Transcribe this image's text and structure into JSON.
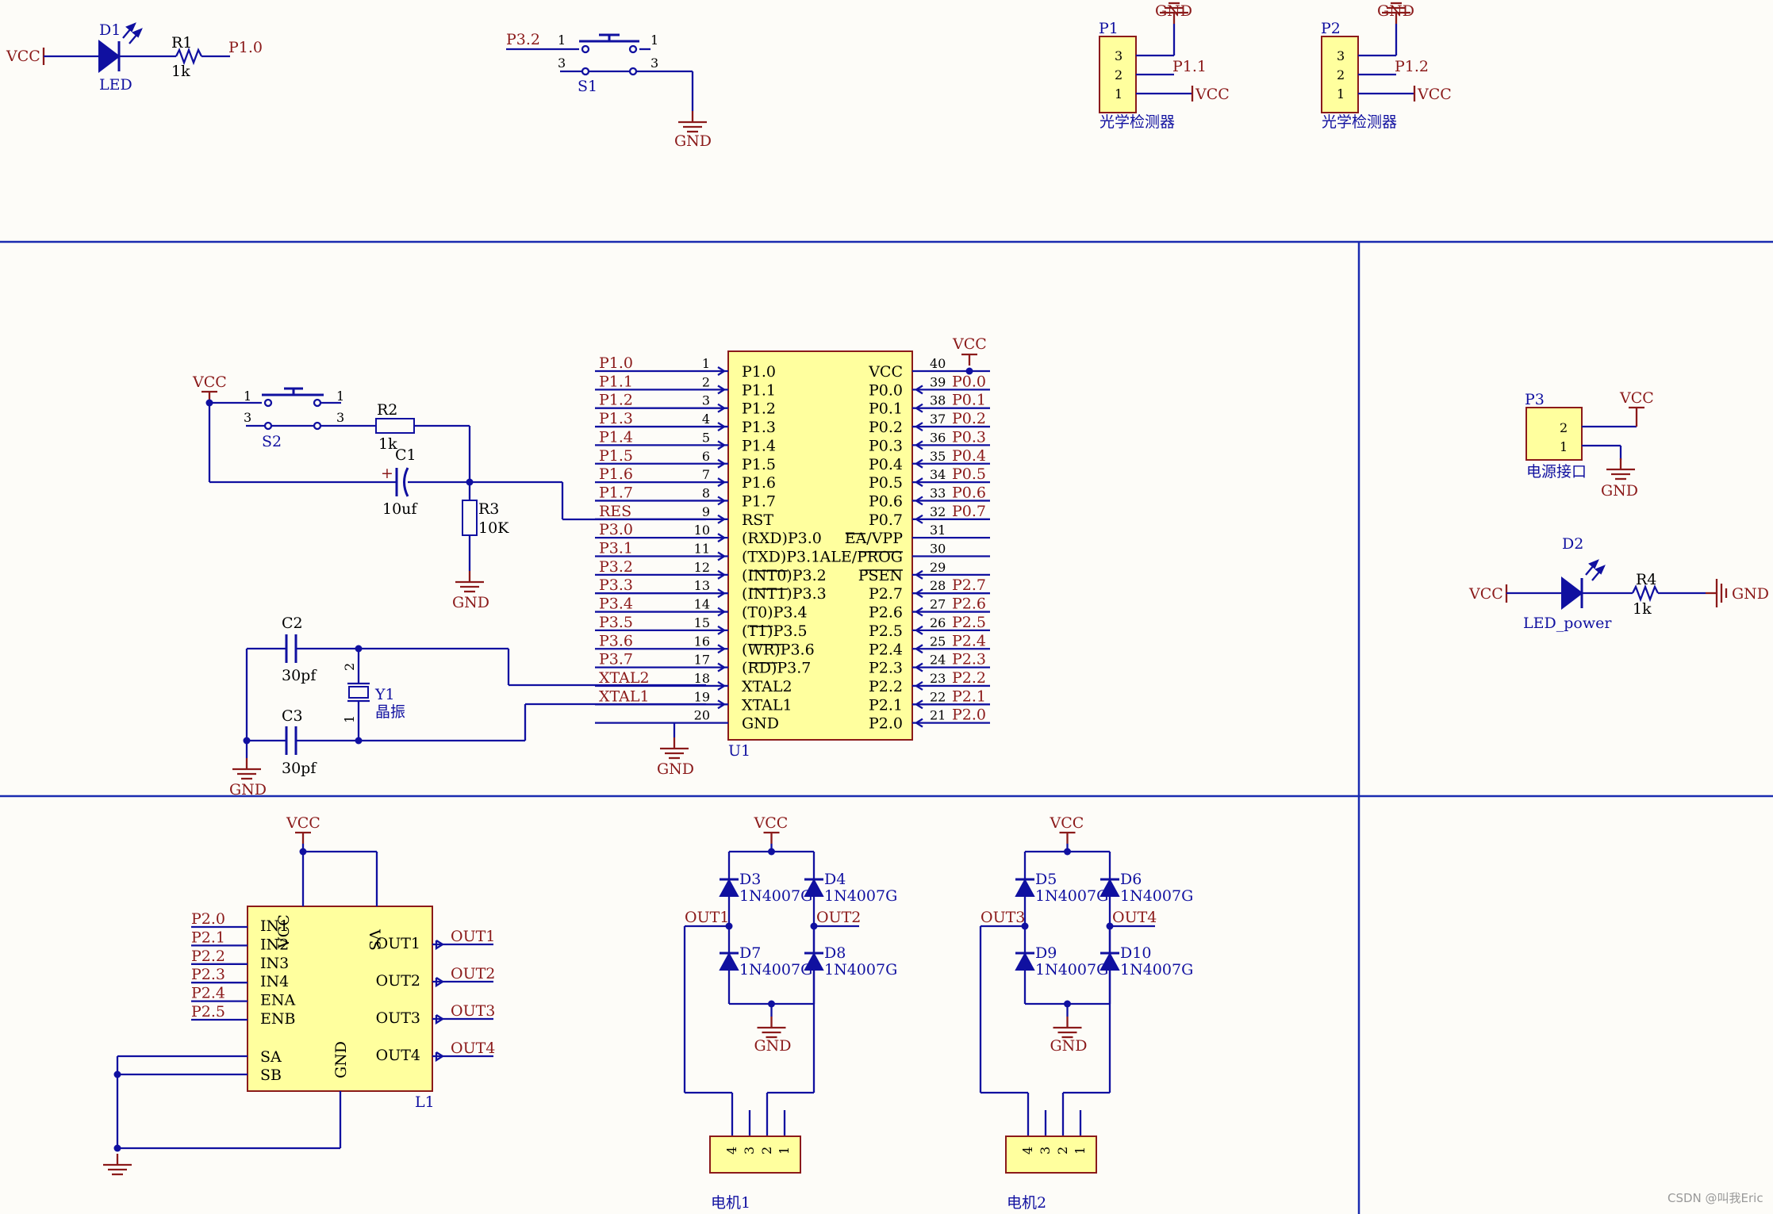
{
  "power": {
    "vcc": "VCC",
    "gnd": "GND"
  },
  "top": {
    "d1": {
      "ref": "D1",
      "name": "LED"
    },
    "r1": {
      "ref": "R1",
      "value": "1k",
      "net": "P1.0"
    },
    "s1": {
      "ref": "S1",
      "net": "P3.2",
      "pin1": "1",
      "pin3": "3"
    },
    "p1": {
      "ref": "P1",
      "net": "P1.1",
      "pins": [
        "3",
        "2",
        "1"
      ],
      "name": "光学检测器"
    },
    "p2": {
      "ref": "P2",
      "net": "P1.2",
      "pins": [
        "3",
        "2",
        "1"
      ],
      "name": "光学检测器"
    }
  },
  "reset": {
    "s2": {
      "ref": "S2",
      "pin1": "1",
      "pin3": "3"
    },
    "r2": {
      "ref": "R2",
      "value": "1k"
    },
    "c1": {
      "ref": "C1",
      "value": "10uf",
      "plus": "+"
    },
    "r3": {
      "ref": "R3",
      "value": "10K"
    }
  },
  "crystal": {
    "c2": {
      "ref": "C2",
      "value": "30pf"
    },
    "c3": {
      "ref": "C3",
      "value": "30pf"
    },
    "y1": {
      "ref": "Y1",
      "name": "晶振",
      "pin1": "1",
      "pin2": "2"
    }
  },
  "mcu": {
    "ref": "U1",
    "left": [
      {
        "num": "1",
        "name": "P1.0",
        "net": "P1.0"
      },
      {
        "num": "2",
        "name": "P1.1",
        "net": "P1.1"
      },
      {
        "num": "3",
        "name": "P1.2",
        "net": "P1.2"
      },
      {
        "num": "4",
        "name": "P1.3",
        "net": "P1.3"
      },
      {
        "num": "5",
        "name": "P1.4",
        "net": "P1.4"
      },
      {
        "num": "6",
        "name": "P1.5",
        "net": "P1.5"
      },
      {
        "num": "7",
        "name": "P1.6",
        "net": "P1.6"
      },
      {
        "num": "8",
        "name": "P1.7",
        "net": "P1.7"
      },
      {
        "num": "9",
        "name": "RST",
        "net": "RES"
      },
      {
        "num": "10",
        "name": "(RXD)P3.0",
        "net": "P3.0"
      },
      {
        "num": "11",
        "name": "(TXD)P3.1",
        "net": "P3.1"
      },
      {
        "num": "12",
        "name": "(INT0)P3.2",
        "net": "P3.2"
      },
      {
        "num": "13",
        "name": "(INT1)P3.3",
        "net": "P3.3"
      },
      {
        "num": "14",
        "name": "(T0)P3.4",
        "net": "P3.4"
      },
      {
        "num": "15",
        "name": "(T1)P3.5",
        "net": "P3.5"
      },
      {
        "num": "16",
        "name": "(WR)P3.6",
        "net": "P3.6"
      },
      {
        "num": "17",
        "name": "(RD)P3.7",
        "net": "P3.7"
      },
      {
        "num": "18",
        "name": "XTAL2",
        "net": "XTAL2"
      },
      {
        "num": "19",
        "name": "XTAL1",
        "net": "XTAL1"
      },
      {
        "num": "20",
        "name": "GND",
        "net": ""
      }
    ],
    "right": [
      {
        "num": "40",
        "name": "VCC",
        "net": ""
      },
      {
        "num": "39",
        "name": "P0.0",
        "net": "P0.0"
      },
      {
        "num": "38",
        "name": "P0.1",
        "net": "P0.1"
      },
      {
        "num": "37",
        "name": "P0.2",
        "net": "P0.2"
      },
      {
        "num": "36",
        "name": "P0.3",
        "net": "P0.3"
      },
      {
        "num": "35",
        "name": "P0.4",
        "net": "P0.4"
      },
      {
        "num": "34",
        "name": "P0.5",
        "net": "P0.5"
      },
      {
        "num": "33",
        "name": "P0.6",
        "net": "P0.6"
      },
      {
        "num": "32",
        "name": "P0.7",
        "net": "P0.7"
      },
      {
        "num": "31",
        "name": "EA/VPP",
        "net": ""
      },
      {
        "num": "30",
        "name": "ALE/PROG",
        "net": ""
      },
      {
        "num": "29",
        "name": "PSEN",
        "net": ""
      },
      {
        "num": "28",
        "name": "P2.7",
        "net": "P2.7"
      },
      {
        "num": "27",
        "name": "P2.6",
        "net": "P2.6"
      },
      {
        "num": "26",
        "name": "P2.5",
        "net": "P2.5"
      },
      {
        "num": "25",
        "name": "P2.4",
        "net": "P2.4"
      },
      {
        "num": "24",
        "name": "P2.3",
        "net": "P2.3"
      },
      {
        "num": "23",
        "name": "P2.2",
        "net": "P2.2"
      },
      {
        "num": "22",
        "name": "P2.1",
        "net": "P2.1"
      },
      {
        "num": "21",
        "name": "P2.0",
        "net": "P2.0"
      }
    ]
  },
  "side": {
    "p3": {
      "ref": "P3",
      "pins": [
        "2",
        "1"
      ],
      "name": "电源接口"
    },
    "d2": {
      "ref": "D2",
      "name": "LED_power"
    },
    "r4": {
      "ref": "R4",
      "value": "1k"
    }
  },
  "driver": {
    "ref": "L1",
    "in_nets": [
      "P2.0",
      "P2.1",
      "P2.2",
      "P2.3",
      "P2.4",
      "P2.5"
    ],
    "in_pins": [
      "IN1",
      "IN2",
      "IN3",
      "IN4",
      "ENA",
      "ENB"
    ],
    "out_pins": [
      "OUT1",
      "OUT2",
      "OUT3",
      "OUT4"
    ],
    "out_nets": [
      "OUT1",
      "OUT2",
      "OUT3",
      "OUT4"
    ],
    "sa": "SA",
    "sb": "SB",
    "vcc": "VCC",
    "vs": "VS",
    "gnd": "GND"
  },
  "motors": [
    {
      "name": "电机1",
      "left_net": "OUT1",
      "right_net": "OUT2",
      "pins": [
        "4",
        "3",
        "2",
        "1"
      ],
      "diodes": [
        {
          "ref": "D3",
          "part": "1N4007G"
        },
        {
          "ref": "D4",
          "part": "1N4007G"
        },
        {
          "ref": "D7",
          "part": "1N4007G"
        },
        {
          "ref": "D8",
          "part": "1N4007G"
        }
      ]
    },
    {
      "name": "电机2",
      "left_net": "OUT3",
      "right_net": "OUT4",
      "pins": [
        "4",
        "3",
        "2",
        "1"
      ],
      "diodes": [
        {
          "ref": "D5",
          "part": "1N4007G"
        },
        {
          "ref": "D6",
          "part": "1N4007G"
        },
        {
          "ref": "D9",
          "part": "1N4007G"
        },
        {
          "ref": "D10",
          "part": "1N4007G"
        }
      ]
    }
  ],
  "watermark": "CSDN @叫我Eric",
  "colors": {
    "wire": "#1010a0",
    "label": "#8b1a1a",
    "component_fill": "#ffff9e",
    "separator": "#1a2bb0"
  }
}
